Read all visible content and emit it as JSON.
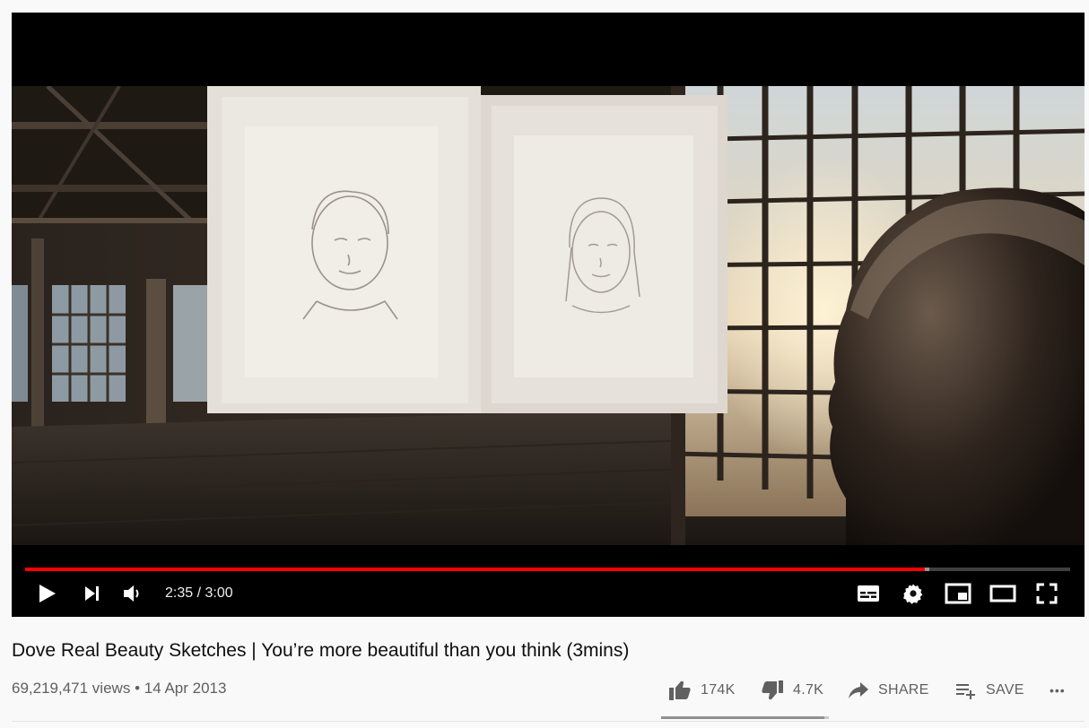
{
  "player": {
    "current_time": "2:35",
    "separator": "/",
    "duration": "3:00",
    "played_fraction": 0.861,
    "loaded_fraction": 0.865
  },
  "video": {
    "title": "Dove Real Beauty Sketches | You’re more beautiful than you think (3mins)",
    "views": "69,219,471 views",
    "dot": "•",
    "date": "14 Apr 2013"
  },
  "actions": {
    "likes": "174K",
    "dislikes": "4.7K",
    "share_label": "SHARE",
    "save_label": "SAVE",
    "more_label": "•••",
    "like_ratio": 0.974
  },
  "colors": {
    "progress_played": "#ff0000",
    "page_bg": "#f9f9f9",
    "text_primary": "#0f0f0f",
    "text_secondary": "#606060"
  },
  "icons": {
    "play": "play-icon",
    "next": "next-icon",
    "volume": "volume-icon",
    "subtitles": "subtitles-icon",
    "settings": "gear-icon",
    "miniplayer": "miniplayer-icon",
    "theater": "theater-mode-icon",
    "fullscreen": "fullscreen-icon",
    "like": "thumbs-up-icon",
    "dislike": "thumbs-down-icon",
    "share": "share-arrow-icon",
    "save": "playlist-add-icon",
    "more": "more-horizontal-icon"
  }
}
